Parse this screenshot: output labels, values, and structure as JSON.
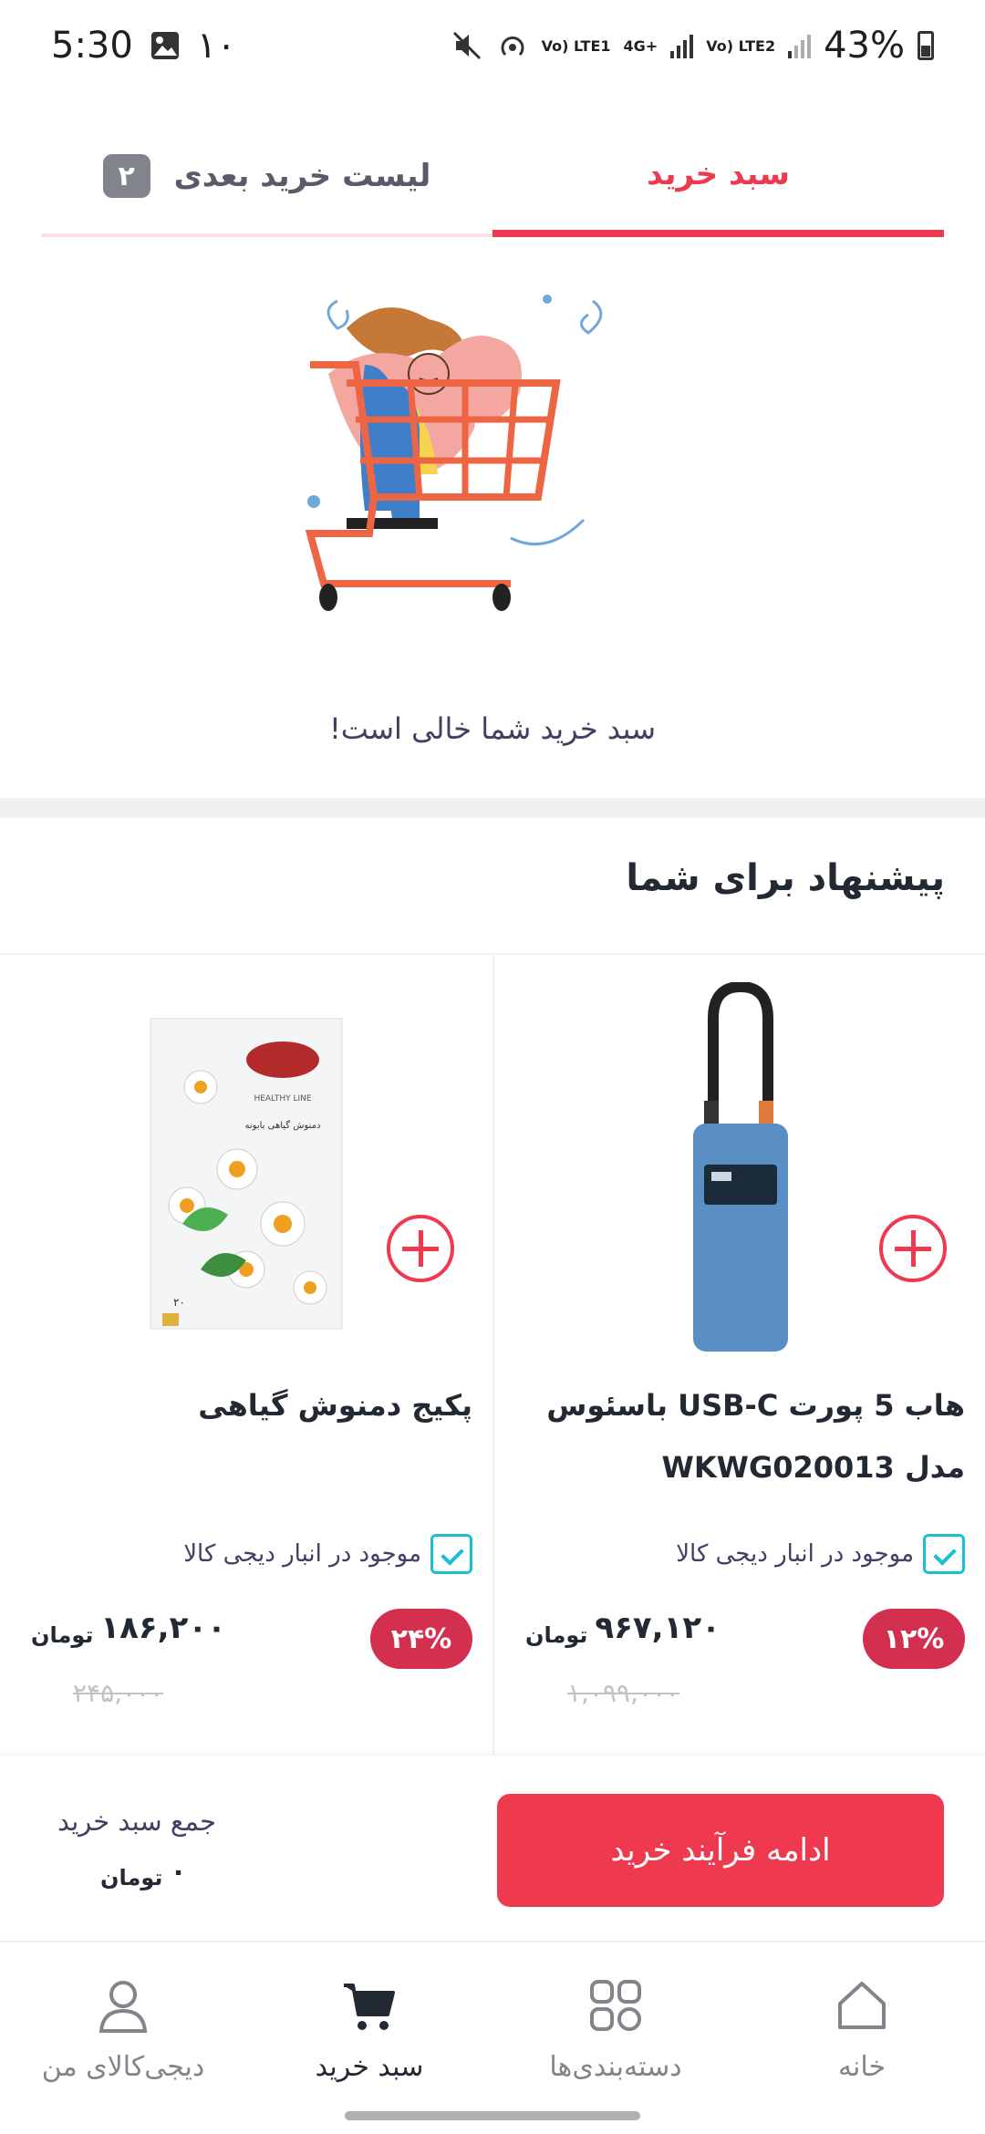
{
  "status_bar": {
    "time": "5:30",
    "notification_count": "۱۰",
    "network1": "Vo) LTE1",
    "network_type": "4G+",
    "network2": "Vo) LTE2",
    "battery": "43%"
  },
  "tabs": {
    "cart": "سبد خرید",
    "next_list": "لیست خرید بعدی",
    "next_list_count": "۲"
  },
  "empty_cart": {
    "message": "سبد خرید شما خالی است!"
  },
  "recommendations": {
    "title": "پیشنهاد برای شما",
    "items": [
      {
        "title": "هاب 5 پورت USB-C باسئوس مدل WKWG020013",
        "stock": "موجود در انبار دیجی کالا",
        "discount": "۱۲%",
        "price": "۹۶۷,۱۲۰",
        "currency": "تومان",
        "old_price": "۱,۰۹۹,۰۰۰"
      },
      {
        "title": "پکیج دمنوش گیاهی",
        "stock": "موجود در انبار دیجی کالا",
        "discount": "۲۴%",
        "price": "۱۸۶,۲۰۰",
        "currency": "تومان",
        "old_price": "۲۴۵,۰۰۰",
        "package_brand_text": "HEALTHY LINE",
        "package_text": "دمنوش گیاهی بابونه",
        "package_count": "۲۰"
      }
    ]
  },
  "summary": {
    "label": "جمع سبد خرید",
    "total": "۰",
    "currency": "تومان",
    "continue_button": "ادامه فرآیند خرید"
  },
  "bottom_nav": {
    "home": "خانه",
    "categories": "دسته‌بندی‌ها",
    "cart": "سبد خرید",
    "my_digikala": "دیجی‌کالای من"
  },
  "colors": {
    "accent": "#ef394e",
    "discount_badge": "#d32f4e",
    "stock_icon": "#19bfd3"
  }
}
